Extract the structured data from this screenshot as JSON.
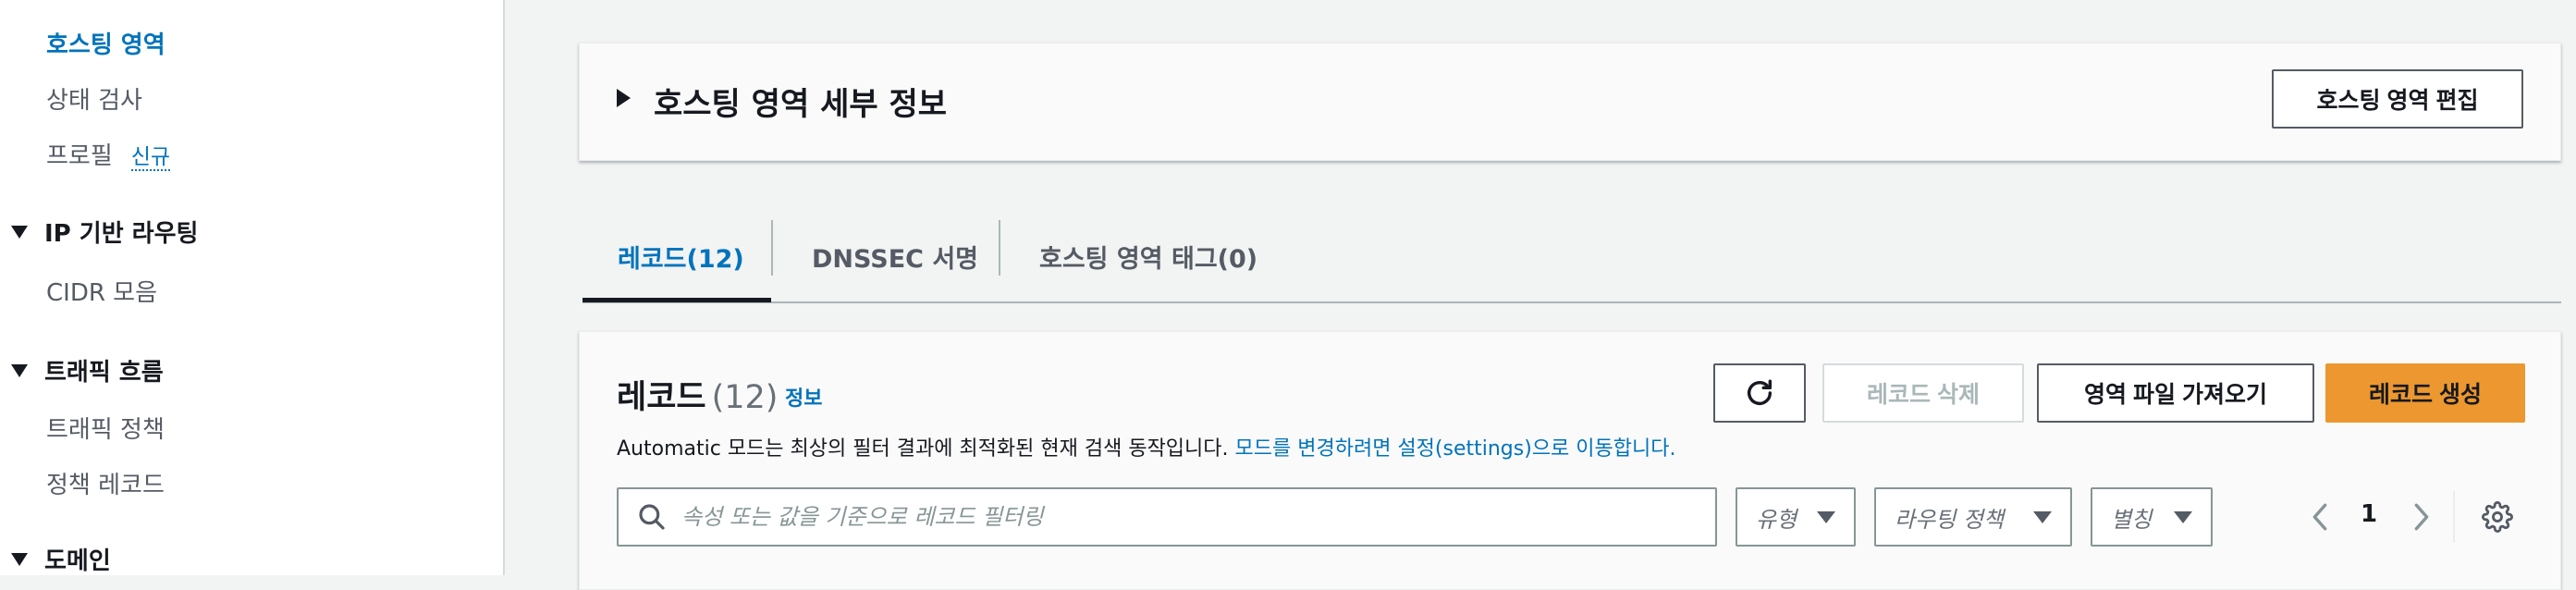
{
  "sidebar": {
    "items": [
      {
        "label": "호스팅 영역"
      },
      {
        "label": "상태 검사"
      },
      {
        "label": "프로필",
        "badge": "신규"
      }
    ],
    "sections": [
      {
        "label": "IP 기반 라우팅",
        "items": [
          {
            "label": "CIDR 모음"
          }
        ]
      },
      {
        "label": "트래픽 흐름",
        "items": [
          {
            "label": "트래픽 정책"
          },
          {
            "label": "정책 레코드"
          }
        ]
      },
      {
        "label": "도메인"
      }
    ]
  },
  "details": {
    "title": "호스팅 영역 세부 정보",
    "edit_button": "호스팅 영역 편집"
  },
  "tabs": [
    {
      "label": "레코드(12)",
      "active": true
    },
    {
      "label": "DNSSEC 서명"
    },
    {
      "label": "호스팅 영역 태그(0)"
    }
  ],
  "records": {
    "title": "레코드",
    "count": "(12)",
    "info_link": "정보",
    "description": "Automatic 모드는 최상의 필터 결과에 최적화된 현재 검색 동작입니다. ",
    "description_link": "모드를 변경하려면 설정(settings)으로 이동합니다.",
    "buttons": {
      "refresh_icon": "refresh-icon",
      "delete": "레코드 삭제",
      "import": "영역 파일 가져오기",
      "create": "레코드 생성"
    },
    "search": {
      "placeholder": "속성 또는 값을 기준으로 레코드 필터링",
      "value": ""
    },
    "filters": {
      "type": "유형",
      "routing_policy": "라우팅 정책",
      "alias": "별칭"
    },
    "pagination": {
      "current_page": "1"
    }
  },
  "colors": {
    "accent": "#0073bb",
    "primary_button": "#ec972f",
    "text": "#16191f",
    "muted": "#545b64",
    "disabled": "#aab7b8"
  }
}
